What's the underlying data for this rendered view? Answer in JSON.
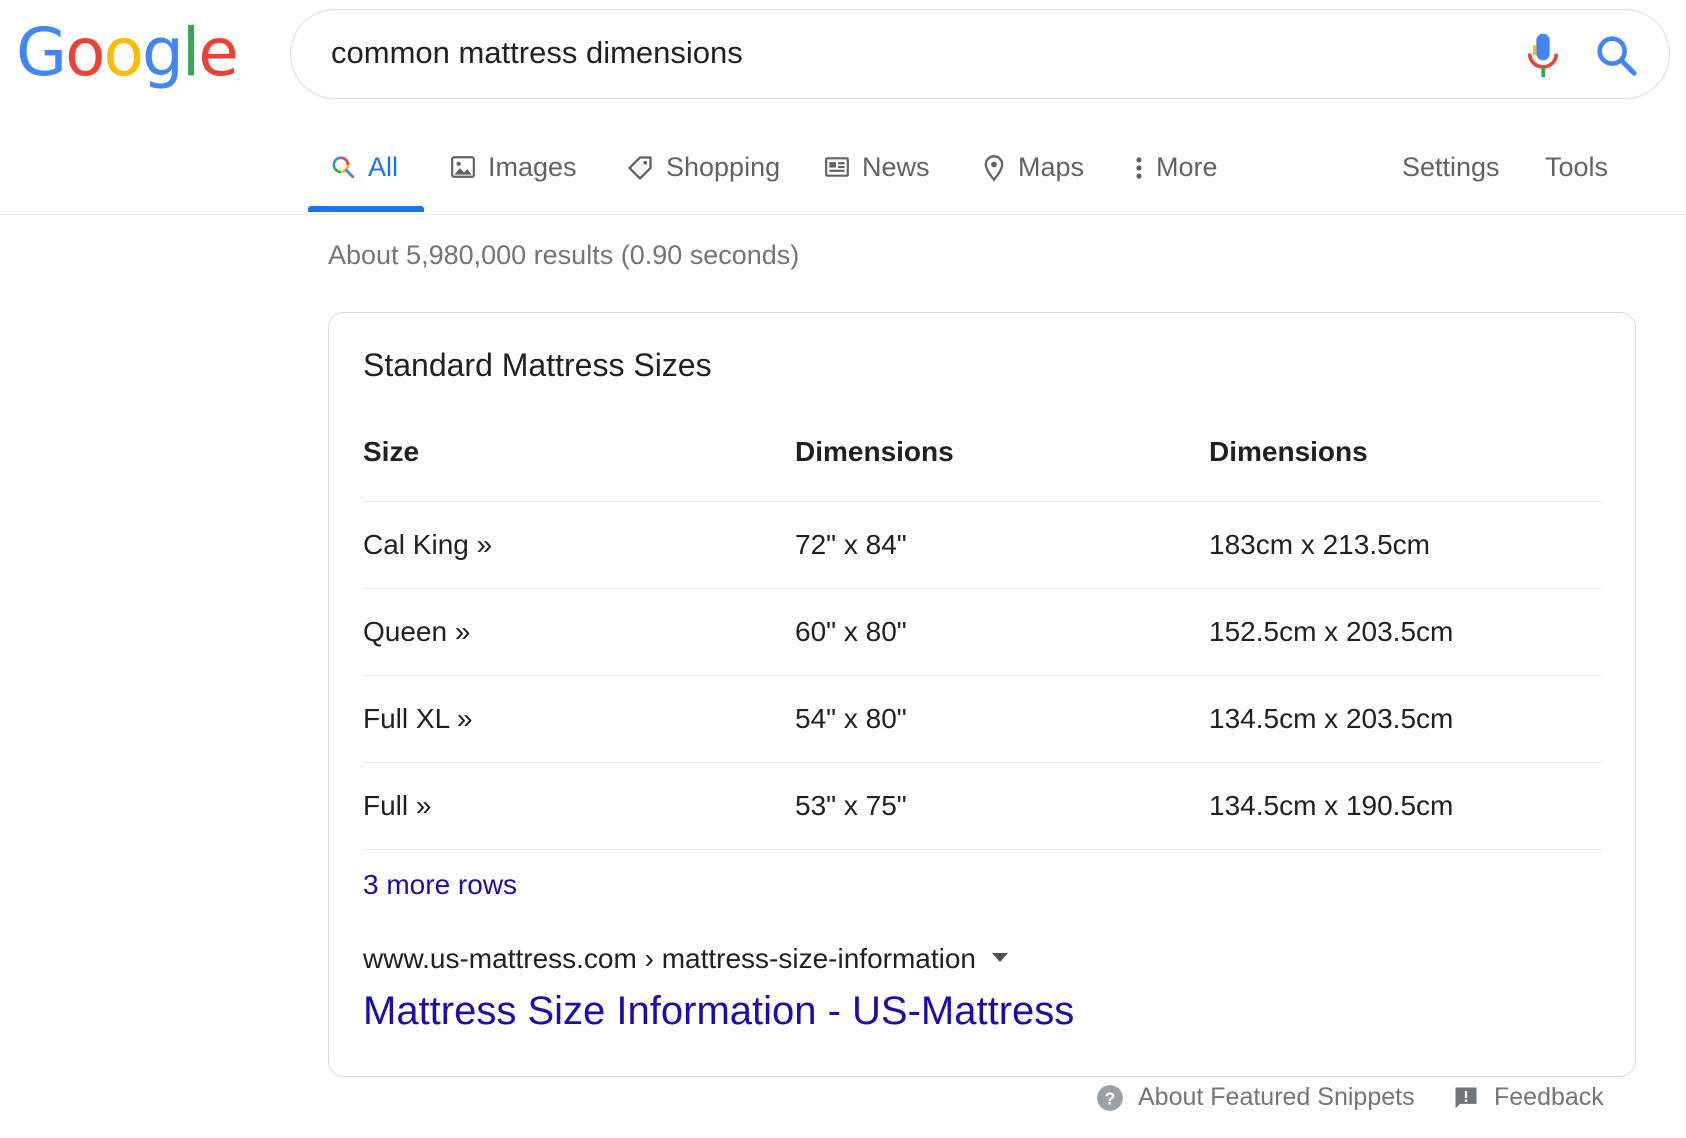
{
  "search": {
    "query": "common mattress dimensions"
  },
  "logo": {
    "letters": [
      {
        "char": "G",
        "color": "#4285F4"
      },
      {
        "char": "o",
        "color": "#EA4335"
      },
      {
        "char": "o",
        "color": "#FBBC05"
      },
      {
        "char": "g",
        "color": "#4285F4"
      },
      {
        "char": "l",
        "color": "#34A853"
      },
      {
        "char": "e",
        "color": "#EA4335"
      }
    ]
  },
  "tabs": [
    {
      "label": "All",
      "icon": "search-multicolor-icon",
      "active": true
    },
    {
      "label": "Images",
      "icon": "image-icon"
    },
    {
      "label": "Shopping",
      "icon": "tag-icon"
    },
    {
      "label": "News",
      "icon": "newspaper-icon"
    },
    {
      "label": "Maps",
      "icon": "map-pin-icon"
    },
    {
      "label": "More",
      "icon": "more-vertical-icon"
    }
  ],
  "tools": {
    "settings": "Settings",
    "tools": "Tools"
  },
  "result_stats": "About 5,980,000 results (0.90 seconds)",
  "snippet": {
    "title": "Standard Mattress Sizes",
    "headers": [
      "Size",
      "Dimensions",
      "Dimensions"
    ],
    "rows": [
      [
        "Cal King »",
        "72\" x 84\"",
        "183cm x 213.5cm"
      ],
      [
        "Queen »",
        "60\" x 80\"",
        "152.5cm x 203.5cm"
      ],
      [
        "Full XL »",
        "54\" x 80\"",
        "134.5cm x 203.5cm"
      ],
      [
        "Full »",
        "53\" x 75\"",
        "134.5cm x 190.5cm"
      ]
    ],
    "more_rows": "3 more rows",
    "cite": "www.us-mattress.com › mattress-size-information",
    "link_title": "Mattress Size Information - US-Mattress"
  },
  "footer": {
    "about": "About Featured Snippets",
    "feedback": "Feedback"
  },
  "colors": {
    "accent": "#1a73e8",
    "link": "#1a0dab",
    "muted": "#70757a"
  }
}
